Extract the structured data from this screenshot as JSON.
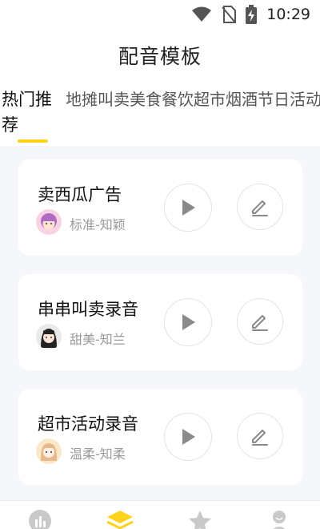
{
  "status_bar": {
    "time": "10:29",
    "icons": [
      "wifi-icon",
      "no-sim-icon",
      "battery-charging-icon"
    ]
  },
  "header": {
    "title": "配音模板"
  },
  "tabs": [
    {
      "label": "热门推荐",
      "active": true
    },
    {
      "label": "地摊叫卖",
      "active": false
    },
    {
      "label": "美食餐饮",
      "active": false
    },
    {
      "label": "超市烟酒",
      "active": false
    },
    {
      "label": "节日活动",
      "active": false
    }
  ],
  "templates": [
    {
      "title": "卖西瓜广告",
      "voice": "标准-知颖",
      "avatar": "avatar-girl-pink"
    },
    {
      "title": "串串叫卖录音",
      "voice": "甜美-知兰",
      "avatar": "avatar-girl-dark-hair"
    },
    {
      "title": "超市活动录音",
      "voice": "温柔-知柔",
      "avatar": "avatar-girl-blonde"
    }
  ],
  "bottom_nav": {
    "items": [
      {
        "icon": "chart-icon",
        "active": false
      },
      {
        "icon": "layers-icon",
        "active": true
      },
      {
        "icon": "star-icon",
        "active": false
      },
      {
        "icon": "profile-icon",
        "active": false
      }
    ]
  },
  "colors": {
    "accent": "#ffd21e",
    "background": "#f5f7fa",
    "card": "#ffffff",
    "muted_text": "#9a9a9a",
    "icon_gray": "#8a8a8a"
  }
}
